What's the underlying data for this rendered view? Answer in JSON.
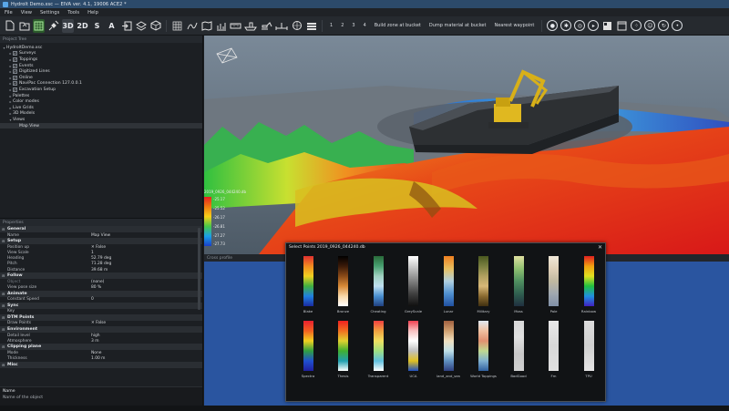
{
  "window": {
    "title": "Hydrolt Demo.xsc — EIVA ver. 4.1, 19006 ACE2 *"
  },
  "menu": [
    "File",
    "View",
    "Settings",
    "Tools",
    "Help"
  ],
  "toolbar": {
    "mode_3d": "3D",
    "mode_2d": "2D",
    "s": "S",
    "a": "A",
    "steps": [
      "1",
      "2",
      "3",
      "4"
    ],
    "build_zone": "Build zone at bucket",
    "dump_material": "Dump material at bucket",
    "nearest_waypoint": "Nearest waypoint"
  },
  "project_panel": {
    "header": "Project Tree",
    "tree": [
      {
        "label": "HydroltDemo.xsc",
        "indent": 0,
        "check": false,
        "caret": "▾"
      },
      {
        "label": "Surveys",
        "indent": 1,
        "check": true,
        "caret": "▸"
      },
      {
        "label": "Toppings",
        "indent": 1,
        "check": true,
        "caret": "▸"
      },
      {
        "label": "Events",
        "indent": 1,
        "check": true,
        "caret": "▸"
      },
      {
        "label": "Digitized Lines",
        "indent": 1,
        "check": true,
        "caret": "▸"
      },
      {
        "label": "Online",
        "indent": 1,
        "check": true,
        "caret": "▸"
      },
      {
        "label": "NaviPac Connection 127.0.0.1",
        "indent": 1,
        "check": true,
        "caret": "▸"
      },
      {
        "label": "Excavation Setup",
        "indent": 1,
        "check": true,
        "caret": "▸"
      },
      {
        "label": "Palettes",
        "indent": 1,
        "check": false,
        "caret": "▸"
      },
      {
        "label": "Color modes",
        "indent": 1,
        "check": false,
        "caret": "▸"
      },
      {
        "label": "Live Grids",
        "indent": 1,
        "check": false,
        "caret": "▸"
      },
      {
        "label": "3D Models",
        "indent": 1,
        "check": false,
        "caret": "▸"
      },
      {
        "label": "Views",
        "indent": 1,
        "check": false,
        "caret": "▾"
      },
      {
        "label": "Map View",
        "indent": 2,
        "check": false,
        "caret": "",
        "selected": true
      }
    ]
  },
  "properties": {
    "header": "Properties",
    "sections": [
      {
        "title": "General",
        "rows": [
          {
            "k": "Name",
            "v": "Map View"
          }
        ]
      },
      {
        "title": "Setup",
        "rows": [
          {
            "k": "Position up",
            "v": "✕  False"
          },
          {
            "k": "View Scale",
            "v": "1"
          },
          {
            "k": "Heading",
            "v": "52.79 deg"
          },
          {
            "k": "Pitch",
            "v": "71.28 deg"
          },
          {
            "k": "Distance",
            "v": "39.68 m"
          }
        ]
      },
      {
        "title": "Follow",
        "rows": [
          {
            "k": "Object",
            "v": "(none)",
            "muted": true
          },
          {
            "k": "View pose size",
            "v": "80 %"
          }
        ]
      },
      {
        "title": "Animate",
        "rows": [
          {
            "k": "Constant Speed",
            "v": "0"
          }
        ]
      },
      {
        "title": "Sync",
        "rows": [
          {
            "k": "Key",
            "v": ""
          }
        ]
      },
      {
        "title": "DTM Points",
        "rows": [
          {
            "k": "Draw Points",
            "v": "✕  False"
          }
        ]
      },
      {
        "title": "Environment",
        "rows": [
          {
            "k": "Detail level",
            "v": "high"
          },
          {
            "k": "Atmosphere",
            "v": "3 m"
          }
        ]
      },
      {
        "title": "Clipping plane",
        "rows": [
          {
            "k": "Mode",
            "v": "None"
          },
          {
            "k": "Thickness",
            "v": "1.00 m"
          }
        ]
      },
      {
        "title": "Misc",
        "rows": []
      }
    ],
    "desc_title": "Name",
    "desc_text": "Name of the object"
  },
  "viewport": {
    "legend_title": "2019_0926_044240.db",
    "legend_values": [
      "-25.17",
      "-25.52",
      "-26.17",
      "-26.81",
      "-27.27",
      "-27.73"
    ]
  },
  "profile_panel": {
    "header": "Cross profile"
  },
  "palette_dialog": {
    "title": "Select Points  2019_0926_044240.db",
    "palettes": [
      {
        "name": "Blake",
        "gradient": [
          "#e03030",
          "#f08a20",
          "#f0d020",
          "#40b040",
          "#2080e0",
          "#1a2aa0"
        ]
      },
      {
        "name": "Bronze",
        "gradient": [
          "#000000",
          "#3a1a08",
          "#8a4a18",
          "#d88a38",
          "#f8d8a8",
          "#ffffff"
        ]
      },
      {
        "name": "Cheating",
        "gradient": [
          "#2a6a3a",
          "#48a070",
          "#a0d0c0",
          "#c0e0f0",
          "#4a90d0",
          "#204080"
        ]
      },
      {
        "name": "GreyScale",
        "gradient": [
          "#ffffff",
          "#c0c0c0",
          "#808080",
          "#404040",
          "#101010"
        ]
      },
      {
        "name": "Lunar",
        "gradient": [
          "#f08020",
          "#e8c060",
          "#b0d0e0",
          "#5090d0",
          "#2050a0"
        ]
      },
      {
        "name": "Military",
        "gradient": [
          "#4a5820",
          "#7a8040",
          "#b0a060",
          "#d8b878",
          "#8a6a30",
          "#403010"
        ]
      },
      {
        "name": "Moss",
        "gradient": [
          "#e0e0a0",
          "#90c070",
          "#509060",
          "#306050",
          "#203040"
        ]
      },
      {
        "name": "Pale",
        "gradient": [
          "#f0e8d8",
          "#e0d0b8",
          "#c0b8a0",
          "#a0a8b0",
          "#8090a8"
        ]
      },
      {
        "name": "Rainbow",
        "gradient": [
          "#e02020",
          "#f0a010",
          "#e0e020",
          "#20c040",
          "#2090e0",
          "#4020c0"
        ]
      },
      {
        "name": "Spectra",
        "gradient": [
          "#e82030",
          "#f06020",
          "#f0d020",
          "#30a040",
          "#2050d0",
          "#2020a0"
        ]
      },
      {
        "name": "Thesis",
        "gradient": [
          "#f02020",
          "#f07020",
          "#e0d030",
          "#40b030",
          "#20a0b0",
          "#ffffff"
        ]
      },
      {
        "name": "Transparent",
        "gradient": [
          "#f04040",
          "#f0a040",
          "#f0e060",
          "#a0e080",
          "#60c0e0",
          "#ffffff"
        ]
      },
      {
        "name": "UCA",
        "gradient": [
          "#f04050",
          "#f8c0c0",
          "#ffffff",
          "#c0c0c0",
          "#e0c020",
          "#2050c0"
        ]
      },
      {
        "name": "land_and_sea",
        "gradient": [
          "#a06040",
          "#d0a070",
          "#f0e0c0",
          "#c0e0e8",
          "#6090c0",
          "#304080"
        ]
      },
      {
        "name": "World Toppings",
        "gradient": [
          "#e0e8f0",
          "#f0c0a0",
          "#e09070",
          "#c0d890",
          "#80b0d0",
          "#3060a0"
        ]
      },
      {
        "name": "BadGood",
        "gradient": [
          "#d8d8d8",
          "#e0e0e0",
          "#c8c8c8",
          "#d0d0d0"
        ]
      },
      {
        "name": "Fm",
        "gradient": [
          "#e8e8e8",
          "#d8d8d8",
          "#e0e0e0"
        ]
      },
      {
        "name": "TPU",
        "gradient": [
          "#dcdcdc",
          "#d0d0d0",
          "#e4e4e4"
        ]
      }
    ]
  }
}
